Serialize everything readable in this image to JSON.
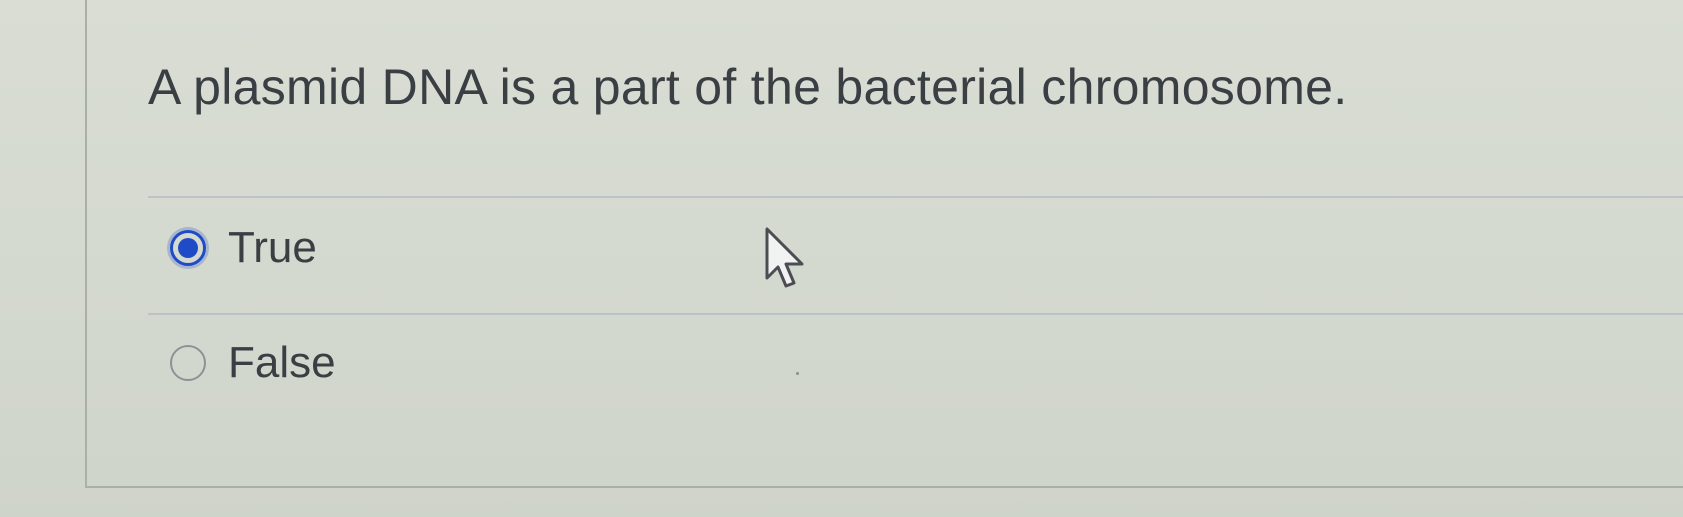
{
  "question": {
    "text": "A plasmid DNA is a part of the bacterial chromosome."
  },
  "options": [
    {
      "label": "True",
      "selected": true
    },
    {
      "label": "False",
      "selected": false
    }
  ],
  "colors": {
    "accent": "#1f4bc7",
    "text": "#3a3f44",
    "background": "#d7dcd3",
    "divider": "#b9c4c6"
  },
  "icons": {
    "pointer": "mouse-pointer-icon"
  }
}
